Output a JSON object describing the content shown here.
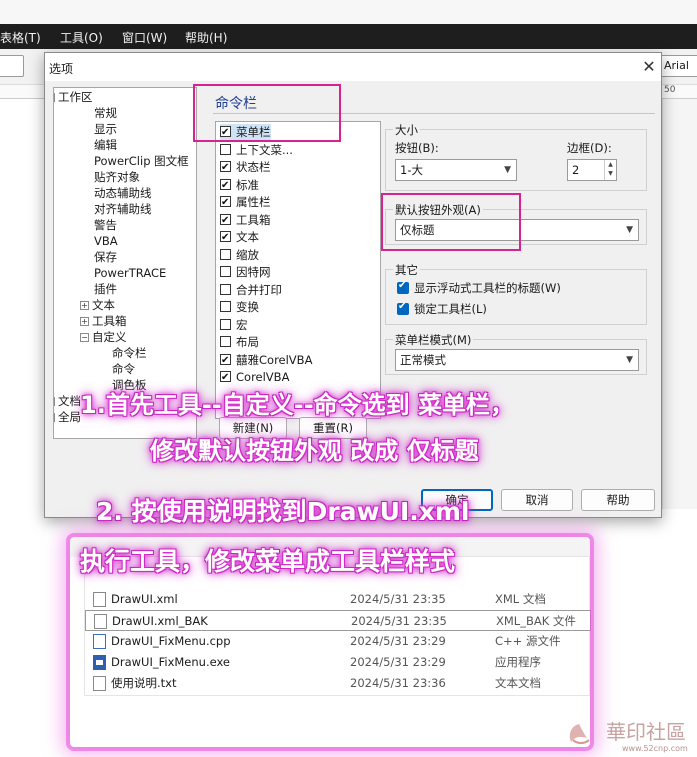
{
  "app_menu": [
    "表格(T)",
    "工具(O)",
    "窗口(W)",
    "帮助(H)"
  ],
  "toolbar": {
    "font_name": "Arial"
  },
  "ruler": {
    "right_number": "50"
  },
  "dialog": {
    "title": "选项",
    "close_glyph": "✕",
    "tree": [
      {
        "label": "工作区",
        "level": 0,
        "expander": "−"
      },
      {
        "label": "常规",
        "level": 1
      },
      {
        "label": "显示",
        "level": 1
      },
      {
        "label": "编辑",
        "level": 1
      },
      {
        "label": "PowerClip 图文框",
        "level": 1
      },
      {
        "label": "贴齐对象",
        "level": 1
      },
      {
        "label": "动态辅助线",
        "level": 1
      },
      {
        "label": "对齐辅助线",
        "level": 1
      },
      {
        "label": "警告",
        "level": 1
      },
      {
        "label": "VBA",
        "level": 1
      },
      {
        "label": "保存",
        "level": 1
      },
      {
        "label": "PowerTRACE",
        "level": 1
      },
      {
        "label": "插件",
        "level": 1
      },
      {
        "label": "文本",
        "level": 1,
        "expander": "+"
      },
      {
        "label": "工具箱",
        "level": 1,
        "expander": "+"
      },
      {
        "label": "自定义",
        "level": 1,
        "expander": "−"
      },
      {
        "label": "命令栏",
        "level": 2
      },
      {
        "label": "命令",
        "level": 2
      },
      {
        "label": "调色板",
        "level": 2
      },
      {
        "label": "文档",
        "level": 0,
        "expander": "+"
      },
      {
        "label": "全局",
        "level": 0,
        "expander": "+"
      }
    ],
    "page_title": "命令栏",
    "commandbars": [
      {
        "label": "菜单栏",
        "checked": true
      },
      {
        "label": "上下文菜...",
        "checked": false
      },
      {
        "label": "状态栏",
        "checked": true
      },
      {
        "label": "标准",
        "checked": true
      },
      {
        "label": "属性栏",
        "checked": true
      },
      {
        "label": "工具箱",
        "checked": true
      },
      {
        "label": "文本",
        "checked": true
      },
      {
        "label": "缩放",
        "checked": false
      },
      {
        "label": "因特网",
        "checked": false
      },
      {
        "label": "合并打印",
        "checked": false
      },
      {
        "label": "变换",
        "checked": false
      },
      {
        "label": "宏",
        "checked": false
      },
      {
        "label": "布局",
        "checked": false
      },
      {
        "label": "囍雅CorelVBA",
        "checked": true
      },
      {
        "label": "CorelVBA",
        "checked": true
      }
    ],
    "new_button": "新建(N)",
    "reset_button": "重置(R)",
    "size_group": {
      "label": "大小",
      "button_label": "按钮(B):",
      "button_value": "1-大",
      "border_label": "边框(D):",
      "border_value": "2"
    },
    "appearance_group": {
      "label": "默认按钮外观(A)",
      "value": "仅标题"
    },
    "other_group": {
      "label": "其它",
      "show_title": "显示浮动式工具栏的标题(W)",
      "lock_toolbar": "锁定工具栏(L)"
    },
    "menubar_mode": {
      "label": "菜单栏模式(M)",
      "value": "正常模式"
    },
    "ok_button": "确定",
    "cancel_button": "取消",
    "help_button": "帮助"
  },
  "explorer": {
    "files": [
      {
        "name": "DrawUI.xml",
        "date": "2024/5/31 23:35",
        "type": "XML 文档",
        "icon": "xml"
      },
      {
        "name": "DrawUI.xml_BAK",
        "date": "2024/5/31 23:35",
        "type": "XML_BAK 文件",
        "icon": "file",
        "selected": true
      },
      {
        "name": "DrawUI_FixMenu.cpp",
        "date": "2024/5/31 23:29",
        "type": "C++ 源文件",
        "icon": "cpp"
      },
      {
        "name": "DrawUI_FixMenu.exe",
        "date": "2024/5/31 23:29",
        "type": "应用程序",
        "icon": "exe"
      },
      {
        "name": "使用说明.txt",
        "date": "2024/5/31 23:36",
        "type": "文本文档",
        "icon": "file"
      }
    ]
  },
  "annotations": {
    "line1": "1.首先工具--自定义--命令选到 菜单栏，",
    "line2": "修改默认按钮外观 改成 仅标题",
    "line3": "2. 按使用说明找到DrawUI.xml",
    "line4": "执行工具，修改菜单成工具栏样式"
  },
  "watermark": {
    "text": "華印社區",
    "url": "www.52cnp.com"
  },
  "colors": {
    "highlight": "#d6238f",
    "glow": "#e23fd6",
    "accent": "#0067c0"
  }
}
